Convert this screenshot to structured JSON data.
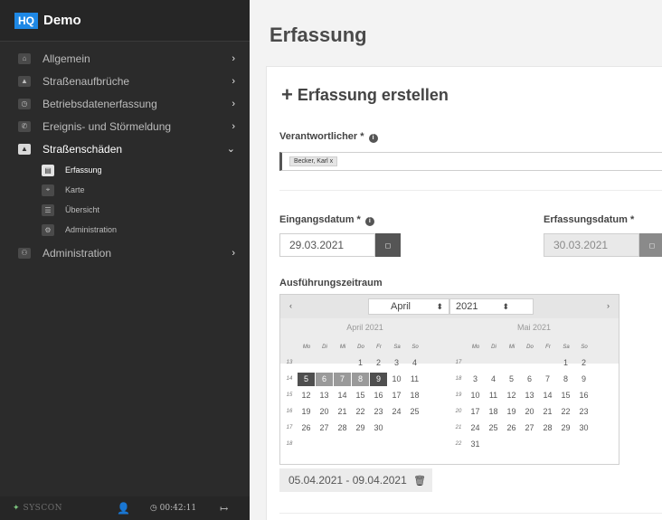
{
  "brand": {
    "logo": "HQ",
    "name": "Demo"
  },
  "nav": [
    {
      "label": "Allgemein",
      "icon": "home-icon",
      "glyph": "⌂",
      "arrow": "›",
      "active": false
    },
    {
      "label": "Straßenaufbrüche",
      "icon": "road-icon",
      "glyph": "▲",
      "arrow": "›",
      "active": false
    },
    {
      "label": "Betriebsdatenerfassung",
      "icon": "clock-icon",
      "glyph": "◷",
      "arrow": "›",
      "active": false
    },
    {
      "label": "Ereignis- und Störmeldung",
      "icon": "phone-icon",
      "glyph": "✆",
      "arrow": "›",
      "active": false
    },
    {
      "label": "Straßenschäden",
      "icon": "road-damage-icon",
      "glyph": "▲",
      "arrow": "⌄",
      "active": true
    }
  ],
  "subnav": [
    {
      "label": "Erfassung",
      "icon": "file-icon",
      "glyph": "▤",
      "active": true
    },
    {
      "label": "Karte",
      "icon": "map-icon",
      "glyph": "⌖",
      "active": false
    },
    {
      "label": "Übersicht",
      "icon": "list-icon",
      "glyph": "☰",
      "active": false
    },
    {
      "label": "Administration",
      "icon": "gear-icon",
      "glyph": "⚙",
      "active": false
    }
  ],
  "nav_bottom": {
    "label": "Administration",
    "icon": "users-icon",
    "glyph": "⚇",
    "arrow": "›"
  },
  "footer": {
    "brand_glyph": "✦",
    "brand": "SYSCON",
    "user_glyph": "👤",
    "timer": "◷ 00:42:11",
    "logout_glyph": "↦"
  },
  "page": {
    "title": "Erfassung"
  },
  "form": {
    "title": "Erfassung erstellen",
    "plus": "+",
    "info_glyph": "i",
    "responsible_label": "Verantwortlicher *",
    "responsible_tag": "Becker, Karl x",
    "received_label": "Eingangsdatum *",
    "received_value": "29.03.2021",
    "recorded_label": "Erfassungsdatum *",
    "recorded_value": "30.03.2021",
    "calendar_button_glyph": "◻",
    "period_label": "Ausführungszeitraum",
    "period_value": "05.04.2021 - 09.04.2021",
    "trash_glyph": "🗑"
  },
  "calendar": {
    "prev": "‹",
    "next": "›",
    "month_select": "April",
    "year_select": "2021",
    "select_arrow": "⬍",
    "weekdays": [
      "Mo",
      "Di",
      "Mi",
      "Do",
      "Fr",
      "Sa",
      "So"
    ],
    "months": [
      {
        "title": "April 2021",
        "weeks": [
          {
            "wk": "13",
            "days": [
              "",
              "",
              "",
              "1",
              "2",
              "3",
              "4"
            ]
          },
          {
            "wk": "14",
            "days": [
              "5",
              "6",
              "7",
              "8",
              "9",
              "10",
              "11"
            ]
          },
          {
            "wk": "15",
            "days": [
              "12",
              "13",
              "14",
              "15",
              "16",
              "17",
              "18"
            ]
          },
          {
            "wk": "16",
            "days": [
              "19",
              "20",
              "21",
              "22",
              "23",
              "24",
              "25"
            ]
          },
          {
            "wk": "17",
            "days": [
              "26",
              "27",
              "28",
              "29",
              "30",
              "",
              ""
            ]
          },
          {
            "wk": "18",
            "days": [
              "",
              "",
              "",
              "",
              "",
              "",
              ""
            ]
          }
        ],
        "range_start": "5",
        "range_end": "9"
      },
      {
        "title": "Mai 2021",
        "weeks": [
          {
            "wk": "17",
            "days": [
              "",
              "",
              "",
              "",
              "",
              "1",
              "2"
            ]
          },
          {
            "wk": "18",
            "days": [
              "3",
              "4",
              "5",
              "6",
              "7",
              "8",
              "9"
            ]
          },
          {
            "wk": "19",
            "days": [
              "10",
              "11",
              "12",
              "13",
              "14",
              "15",
              "16"
            ]
          },
          {
            "wk": "20",
            "days": [
              "17",
              "18",
              "19",
              "20",
              "21",
              "22",
              "23"
            ]
          },
          {
            "wk": "21",
            "days": [
              "24",
              "25",
              "26",
              "27",
              "28",
              "29",
              "30"
            ]
          },
          {
            "wk": "22",
            "days": [
              "31",
              "",
              "",
              "",
              "",
              "",
              ""
            ]
          }
        ]
      }
    ]
  }
}
